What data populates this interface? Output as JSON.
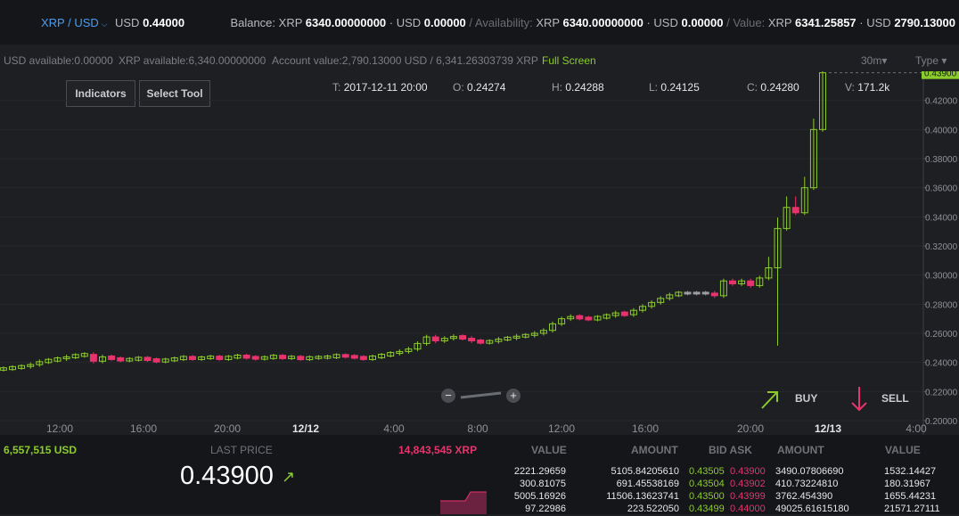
{
  "top": {
    "pair": "XRP / USD",
    "price_label": "USD",
    "price_value": "0.44000",
    "balance_label": "Balance:",
    "balance_xrp_label": "XRP",
    "balance_xrp": "6340.00000000",
    "balance_usd_label": "· USD",
    "balance_usd": "0.00000",
    "availability_label": "/ Availability:",
    "avail_xrp_label": "XRP",
    "avail_xrp": "6340.00000000",
    "avail_usd_label": "· USD",
    "avail_usd": "0.00000",
    "value_label": "/ Value:",
    "value_xrp_label": "XRP",
    "value_xrp": "6341.25857",
    "value_usd_label": "· USD",
    "value_usd": "2790.13000"
  },
  "info": {
    "usd_available": "USD available:0.00000",
    "xrp_available": "XRP available:6,340.00000000",
    "account_value": "Account value:2,790.13000 USD / 6,341.26303739 XRP",
    "full_screen": "Full Screen",
    "interval": "30m▾",
    "type": "Type ▾"
  },
  "tools": {
    "indicators": "Indicators",
    "select_tool": "Select Tool"
  },
  "ohlc": {
    "t_label": "T:",
    "t": "2017-12-11 20:00",
    "o_label": "O:",
    "o": "0.24274",
    "h_label": "H:",
    "h": "0.24288",
    "l_label": "L:",
    "l": "0.24125",
    "c_label": "C:",
    "c": "0.24280",
    "v_label": "V:",
    "v": "171.2k"
  },
  "trade": {
    "buy": "BUY",
    "sell": "SELL"
  },
  "colors": {
    "up": "#8ccc2a",
    "down": "#e8336d",
    "flat": "#9a9da2",
    "background": "#1e1f23"
  },
  "chart_data": {
    "type": "candlestick",
    "last_price_tag": "0.43900",
    "ylim": [
      0.2,
      0.44
    ],
    "y_ticks": [
      "0.20000",
      "0.22000",
      "0.24000",
      "0.26000",
      "0.28000",
      "0.30000",
      "0.32000",
      "0.34000",
      "0.36000",
      "0.38000",
      "0.40000",
      "0.42000"
    ],
    "x_ticks": [
      "12:00",
      "16:00",
      "20:00",
      "12/12",
      "4:00",
      "8:00",
      "12:00",
      "16:00",
      "20:00",
      "12/13",
      "4:00"
    ],
    "x_ticks_bold": [
      "12/12",
      "12/13"
    ],
    "close": [
      0.2353,
      0.2357,
      0.2365,
      0.2372,
      0.2385,
      0.2405,
      0.2415,
      0.2425,
      0.2438,
      0.2448,
      0.2455,
      0.2408,
      0.2438,
      0.2426,
      0.2416,
      0.2421,
      0.2429,
      0.2419,
      0.2409,
      0.2417,
      0.2425,
      0.2435,
      0.2426,
      0.2432,
      0.2437,
      0.2426,
      0.2436,
      0.2444,
      0.2435,
      0.2428,
      0.2433,
      0.2443,
      0.2432,
      0.2436,
      0.2425,
      0.2433,
      0.2435,
      0.2438,
      0.2448,
      0.2442,
      0.2435,
      0.2426,
      0.2438,
      0.245,
      0.2462,
      0.2475,
      0.2492,
      0.253,
      0.2575,
      0.2548,
      0.2565,
      0.2578,
      0.2566,
      0.2548,
      0.2538,
      0.2544,
      0.256,
      0.2567,
      0.258,
      0.2586,
      0.26,
      0.262,
      0.2665,
      0.27,
      0.2715,
      0.2705,
      0.2698,
      0.271,
      0.2722,
      0.274,
      0.2728,
      0.2758,
      0.2785,
      0.2812,
      0.284,
      0.2864,
      0.2876,
      0.2876,
      0.2876,
      0.2876,
      0.2858,
      0.296,
      0.294,
      0.296,
      0.2928,
      0.298,
      0.305,
      0.332,
      0.3465,
      0.3428,
      0.36,
      0.4,
      0.439
    ],
    "open": [
      0.2348,
      0.2353,
      0.2357,
      0.2365,
      0.2372,
      0.2385,
      0.2405,
      0.2415,
      0.2425,
      0.2438,
      0.2448,
      0.2455,
      0.2408,
      0.2438,
      0.2426,
      0.2416,
      0.2421,
      0.2429,
      0.2419,
      0.2409,
      0.2417,
      0.2425,
      0.2435,
      0.2426,
      0.2432,
      0.2437,
      0.2426,
      0.2436,
      0.2444,
      0.2435,
      0.2428,
      0.2433,
      0.2443,
      0.2432,
      0.2436,
      0.2425,
      0.2433,
      0.2435,
      0.2438,
      0.2448,
      0.2442,
      0.2435,
      0.2426,
      0.2438,
      0.245,
      0.2462,
      0.2475,
      0.2492,
      0.253,
      0.2575,
      0.2548,
      0.2565,
      0.2578,
      0.2566,
      0.2548,
      0.2538,
      0.2544,
      0.256,
      0.2567,
      0.258,
      0.2586,
      0.26,
      0.262,
      0.2665,
      0.27,
      0.2715,
      0.2705,
      0.2698,
      0.271,
      0.2722,
      0.274,
      0.2728,
      0.2758,
      0.2785,
      0.2812,
      0.284,
      0.2864,
      0.2876,
      0.2876,
      0.2876,
      0.2876,
      0.2858,
      0.296,
      0.294,
      0.296,
      0.2928,
      0.298,
      0.305,
      0.332,
      0.3465,
      0.3428,
      0.36,
      0.4
    ]
  },
  "bottom": {
    "usd_volume": "6,557,515 USD",
    "last_price_label": "LAST PRICE",
    "xrp_volume": "14,843,545 XRP",
    "last_price": "0.43900",
    "headers": [
      "VALUE",
      "AMOUNT",
      "BID ASK",
      "AMOUNT",
      "VALUE"
    ],
    "rows": [
      {
        "bid_value": "2221.29659",
        "bid_amount": "5105.84205610",
        "bid": "0.43505",
        "ask": "0.43900",
        "ask_amount": "3490.07806690",
        "ask_value": "1532.14427"
      },
      {
        "bid_value": "300.81075",
        "bid_amount": "691.45538169",
        "bid": "0.43504",
        "ask": "0.43902",
        "ask_amount": "410.73224810",
        "ask_value": "180.31967"
      },
      {
        "bid_value": "5005.16926",
        "bid_amount": "11506.13623741",
        "bid": "0.43500",
        "ask": "0.43999",
        "ask_amount": "3762.454390",
        "ask_value": "1655.44231"
      },
      {
        "bid_value": "97.22986",
        "bid_amount": "223.522050",
        "bid": "0.43499",
        "ask": "0.44000",
        "ask_amount": "49025.61615180",
        "ask_value": "21571.27111"
      }
    ]
  }
}
